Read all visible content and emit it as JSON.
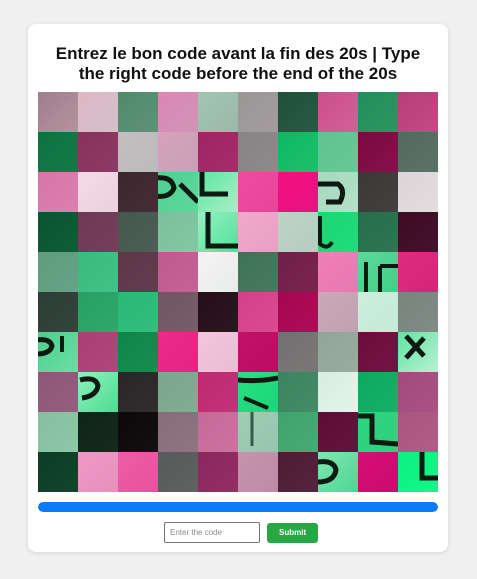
{
  "page": {
    "background": "#f0f0f0",
    "title": "Entrez le bon code avant la fin des 20s | Type the right code before the end of the 20s"
  },
  "captcha": {
    "columns": 10,
    "rows": 10,
    "tiles": [
      {
        "colors": [
          "#9e7f8e",
          "#b7929e"
        ],
        "glyph": "none"
      },
      {
        "colors": [
          "#ddb8c6",
          "#d3c0c9"
        ],
        "glyph": "none"
      },
      {
        "colors": [
          "#4f8a6b",
          "#5e9277"
        ],
        "glyph": "none"
      },
      {
        "colors": [
          "#dc86b4",
          "#d095b7"
        ],
        "glyph": "none"
      },
      {
        "colors": [
          "#a3c6b3",
          "#9bb8a8"
        ],
        "glyph": "none"
      },
      {
        "colors": [
          "#9a9796",
          "#a39c9e"
        ],
        "glyph": "none"
      },
      {
        "colors": [
          "#20503a",
          "#2a5a42"
        ],
        "glyph": "none"
      },
      {
        "colors": [
          "#cc4f8c",
          "#d4609a"
        ],
        "glyph": "none"
      },
      {
        "colors": [
          "#238e5a",
          "#2c9663"
        ],
        "glyph": "none"
      },
      {
        "colors": [
          "#b83e78",
          "#c34a85"
        ],
        "glyph": "none"
      },
      {
        "colors": [
          "#0b7240",
          "#137a48"
        ],
        "glyph": "none"
      },
      {
        "colors": [
          "#85325c",
          "#8e3a65"
        ],
        "glyph": "none"
      },
      {
        "colors": [
          "#c4bdc0",
          "#bcbcbc"
        ],
        "glyph": "none"
      },
      {
        "colors": [
          "#d5a2bc",
          "#caa0b6"
        ],
        "glyph": "none"
      },
      {
        "colors": [
          "#9e2462",
          "#a62c6a"
        ],
        "glyph": "none"
      },
      {
        "colors": [
          "#888385",
          "#8e8a8c"
        ],
        "glyph": "none"
      },
      {
        "colors": [
          "#10b862",
          "#1cc06b"
        ],
        "glyph": "none"
      },
      {
        "colors": [
          "#5ec38f",
          "#66c996"
        ],
        "glyph": "none"
      },
      {
        "colors": [
          "#7a0a42",
          "#84124b"
        ],
        "glyph": "none"
      },
      {
        "colors": [
          "#536a5f",
          "#5b7267"
        ],
        "glyph": "none"
      },
      {
        "colors": [
          "#d675a8",
          "#dc80b0"
        ],
        "glyph": "none"
      },
      {
        "colors": [
          "#f3dbe6",
          "#ebd0dd"
        ],
        "glyph": "none"
      },
      {
        "colors": [
          "#3c272f",
          "#442e36"
        ],
        "glyph": "none"
      },
      {
        "colors": [
          "#4fcf91",
          "#5fd79c"
        ],
        "glyph": "left-a"
      },
      {
        "colors": [
          "#5ee6a0",
          "#a8efc8"
        ],
        "glyph": "top-a"
      },
      {
        "colors": [
          "#f14ba1",
          "#e9439a"
        ],
        "glyph": "none"
      },
      {
        "colors": [
          "#f20f80",
          "#ea1280"
        ],
        "glyph": "none"
      },
      {
        "colors": [
          "#a6d9bd",
          "#b5e0c7"
        ],
        "glyph": "left-b"
      },
      {
        "colors": [
          "#3c3838",
          "#444040"
        ],
        "glyph": "none"
      },
      {
        "colors": [
          "#dcd4d8",
          "#e4dde0"
        ],
        "glyph": "none"
      },
      {
        "colors": [
          "#0a5531",
          "#125c38"
        ],
        "glyph": "none"
      },
      {
        "colors": [
          "#6e3955",
          "#76405c"
        ],
        "glyph": "none"
      },
      {
        "colors": [
          "#45574f",
          "#4c5e56"
        ],
        "glyph": "none"
      },
      {
        "colors": [
          "#7bc09c",
          "#83c7a3"
        ],
        "glyph": "none"
      },
      {
        "colors": [
          "#9af0c3",
          "#4ee296"
        ],
        "glyph": "corner"
      },
      {
        "colors": [
          "#f0a9cc",
          "#e89fc4"
        ],
        "glyph": "none"
      },
      {
        "colors": [
          "#bcd4c6",
          "#b5cdbf"
        ],
        "glyph": "none"
      },
      {
        "colors": [
          "#1ad673",
          "#22dc7a"
        ],
        "glyph": "right-a"
      },
      {
        "colors": [
          "#276e4b",
          "#2e7552"
        ],
        "glyph": "none"
      },
      {
        "colors": [
          "#3c0c25",
          "#44122c"
        ],
        "glyph": "none"
      },
      {
        "colors": [
          "#5f9c7e",
          "#67a386"
        ],
        "glyph": "none"
      },
      {
        "colors": [
          "#39bb7e",
          "#41c286"
        ],
        "glyph": "none"
      },
      {
        "colors": [
          "#5c3748",
          "#643e50"
        ],
        "glyph": "none"
      },
      {
        "colors": [
          "#bf5a8e",
          "#c76296"
        ],
        "glyph": "none"
      },
      {
        "colors": [
          "#f4f4f4",
          "#e8ece9"
        ],
        "glyph": "none"
      },
      {
        "colors": [
          "#3f7357",
          "#477a5f"
        ],
        "glyph": "none"
      },
      {
        "colors": [
          "#701f47",
          "#78264f"
        ],
        "glyph": "none"
      },
      {
        "colors": [
          "#f07fb8",
          "#e878b1"
        ],
        "glyph": "none"
      },
      {
        "colors": [
          "#5fd89b",
          "#3ed086"
        ],
        "glyph": "bars"
      },
      {
        "colors": [
          "#de2b7f",
          "#d62578"
        ],
        "glyph": "none"
      },
      {
        "colors": [
          "#2c3d35",
          "#34453d"
        ],
        "glyph": "none"
      },
      {
        "colors": [
          "#26a063",
          "#2ea86b"
        ],
        "glyph": "none"
      },
      {
        "colors": [
          "#2ab775",
          "#32bf7d"
        ],
        "glyph": "none"
      },
      {
        "colors": [
          "#6f5661",
          "#775e69"
        ],
        "glyph": "none"
      },
      {
        "colors": [
          "#240f18",
          "#2c1620"
        ],
        "glyph": "none"
      },
      {
        "colors": [
          "#d2428a",
          "#da4a92"
        ],
        "glyph": "none"
      },
      {
        "colors": [
          "#a4074f",
          "#ac0f57"
        ],
        "glyph": "none"
      },
      {
        "colors": [
          "#c9a9b8",
          "#c1a1b0"
        ],
        "glyph": "none"
      },
      {
        "colors": [
          "#cdeedd",
          "#c2ebd6"
        ],
        "glyph": "none"
      },
      {
        "colors": [
          "#7a847f",
          "#828c87"
        ],
        "glyph": "none"
      },
      {
        "colors": [
          "#4dcc8d",
          "#6ae0a3"
        ],
        "glyph": "left-c"
      },
      {
        "colors": [
          "#a83e72",
          "#b0467a"
        ],
        "glyph": "none"
      },
      {
        "colors": [
          "#108548",
          "#188d50"
        ],
        "glyph": "none"
      },
      {
        "colors": [
          "#ec2a8a",
          "#e42384"
        ],
        "glyph": "none"
      },
      {
        "colors": [
          "#f3c5dc",
          "#ebbdd4"
        ],
        "glyph": "none"
      },
      {
        "colors": [
          "#c2126a",
          "#ba0c63"
        ],
        "glyph": "none"
      },
      {
        "colors": [
          "#727070",
          "#7a7777"
        ],
        "glyph": "none"
      },
      {
        "colors": [
          "#91a598",
          "#99ad9f"
        ],
        "glyph": "none"
      },
      {
        "colors": [
          "#6b0e3c",
          "#731544"
        ],
        "glyph": "none"
      },
      {
        "colors": [
          "#62e3a1",
          "#b9f1d2"
        ],
        "glyph": "right-b"
      },
      {
        "colors": [
          "#8d5777",
          "#955f7f"
        ],
        "glyph": "none"
      },
      {
        "colors": [
          "#8ff0bd",
          "#4fdb91"
        ],
        "glyph": "mid-a"
      },
      {
        "colors": [
          "#282627",
          "#302e2f"
        ],
        "glyph": "none"
      },
      {
        "colors": [
          "#7aa68c",
          "#82ad93"
        ],
        "glyph": "none"
      },
      {
        "colors": [
          "#be2a72",
          "#c6327a"
        ],
        "glyph": "none"
      },
      {
        "colors": [
          "#27e183",
          "#1cd479"
        ],
        "glyph": "top-b"
      },
      {
        "colors": [
          "#3c845f",
          "#448c67"
        ],
        "glyph": "none"
      },
      {
        "colors": [
          "#d8eedf",
          "#e3f4e9"
        ],
        "glyph": "none"
      },
      {
        "colors": [
          "#0ea85e",
          "#16b066"
        ],
        "glyph": "none"
      },
      {
        "colors": [
          "#a34a7c",
          "#ab5284"
        ],
        "glyph": "none"
      },
      {
        "colors": [
          "#86bfa0",
          "#8ec7a8"
        ],
        "glyph": "none"
      },
      {
        "colors": [
          "#0e2417",
          "#162b1e"
        ],
        "glyph": "none"
      },
      {
        "colors": [
          "#0b080a",
          "#131012"
        ],
        "glyph": "none"
      },
      {
        "colors": [
          "#876d7a",
          "#8f7582"
        ],
        "glyph": "none"
      },
      {
        "colors": [
          "#c56a98",
          "#cd72a0"
        ],
        "glyph": "none"
      },
      {
        "colors": [
          "#9fcdb4",
          "#97c4ac"
        ],
        "glyph": "left-d"
      },
      {
        "colors": [
          "#3ea36d",
          "#46ab75"
        ],
        "glyph": "none"
      },
      {
        "colors": [
          "#5c0d35",
          "#64143d"
        ],
        "glyph": "none"
      },
      {
        "colors": [
          "#2dd680",
          "#2fcf7d"
        ],
        "glyph": "corner-b"
      },
      {
        "colors": [
          "#a85680",
          "#b05e88"
        ],
        "glyph": "none"
      },
      {
        "colors": [
          "#0c3d24",
          "#14452c"
        ],
        "glyph": "none"
      },
      {
        "colors": [
          "#f098c5",
          "#e890bd"
        ],
        "glyph": "none"
      },
      {
        "colors": [
          "#f05aa6",
          "#e8529e"
        ],
        "glyph": "none"
      },
      {
        "colors": [
          "#575a58",
          "#5f6260"
        ],
        "glyph": "none"
      },
      {
        "colors": [
          "#8a285d",
          "#923065"
        ],
        "glyph": "none"
      },
      {
        "colors": [
          "#c593ad",
          "#bd8ba5"
        ],
        "glyph": "none"
      },
      {
        "colors": [
          "#4c1d35",
          "#54253d"
        ],
        "glyph": "none"
      },
      {
        "colors": [
          "#7fe6b0",
          "#4ed693"
        ],
        "glyph": "bottom-a"
      },
      {
        "colors": [
          "#d40f74",
          "#cc096c"
        ],
        "glyph": "none"
      },
      {
        "colors": [
          "#0cf07f",
          "#14f887"
        ],
        "glyph": "right-c"
      }
    ]
  },
  "timer": {
    "progress_fraction": 1.0,
    "fill_color": "#0a7cf5"
  },
  "form": {
    "input_value": "",
    "input_placeholder": "Enter the code",
    "submit_label": "Submit",
    "submit_color": "#28a745"
  }
}
